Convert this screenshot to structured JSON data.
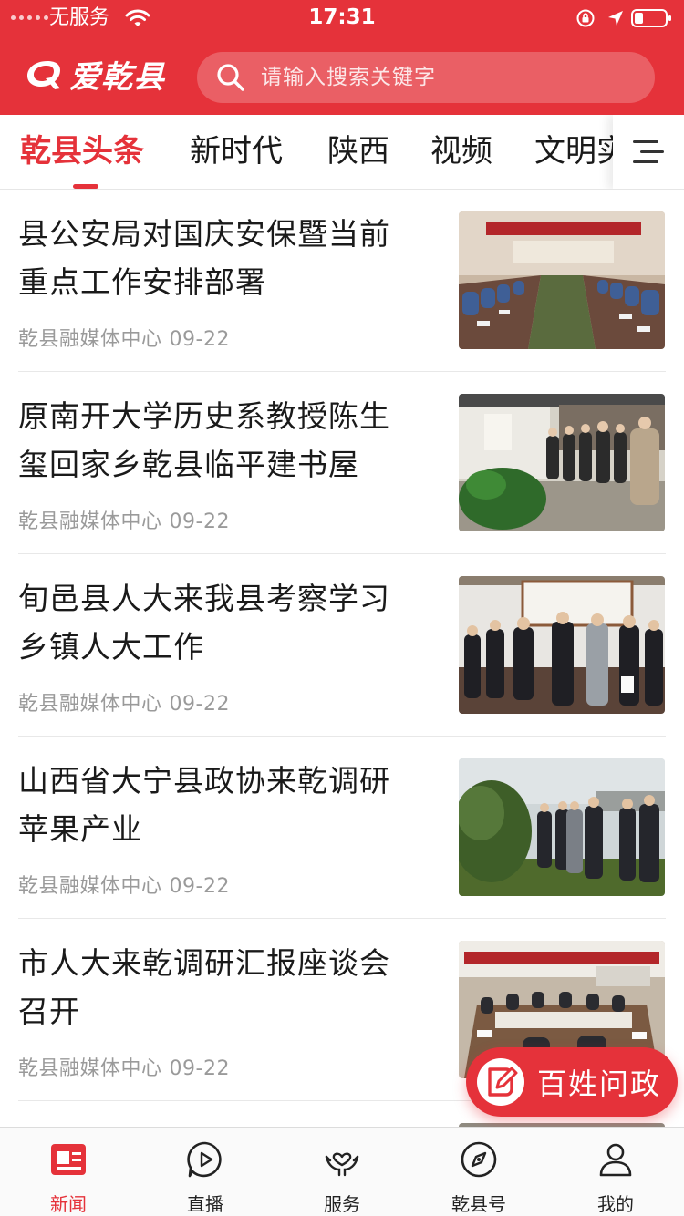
{
  "status_bar": {
    "carrier": "无服务",
    "time": "17:31"
  },
  "header": {
    "logo_text": "爱乾县",
    "search": {
      "placeholder": "请输入搜索关键字"
    }
  },
  "tabs": [
    {
      "label": "乾县头条",
      "active": true
    },
    {
      "label": "新时代",
      "active": false
    },
    {
      "label": "陕西",
      "active": false
    },
    {
      "label": "视频",
      "active": false
    },
    {
      "label": "文明实",
      "active": false
    }
  ],
  "news": [
    {
      "title": "县公安局对国庆安保暨当前重点工作安排部署",
      "source": "乾县融媒体中心",
      "date": "09-22"
    },
    {
      "title": "原南开大学历史系教授陈生玺回家乡乾县临平建书屋",
      "source": "乾县融媒体中心",
      "date": "09-22"
    },
    {
      "title": "旬邑县人大来我县考察学习乡镇人大工作",
      "source": "乾县融媒体中心",
      "date": "09-22"
    },
    {
      "title": "山西省大宁县政协来乾调研苹果产业",
      "source": "乾县融媒体中心",
      "date": "09-22"
    },
    {
      "title": "市人大来乾调研汇报座谈会召开",
      "source": "乾县融媒体中心",
      "date": "09-22"
    }
  ],
  "fab": {
    "label": "百姓问政"
  },
  "bottom_nav": [
    {
      "label": "新闻",
      "icon": "news-icon",
      "active": true
    },
    {
      "label": "直播",
      "icon": "play-icon",
      "active": false
    },
    {
      "label": "服务",
      "icon": "service-icon",
      "active": false
    },
    {
      "label": "乾县号",
      "icon": "compass-icon",
      "active": false
    },
    {
      "label": "我的",
      "icon": "user-icon",
      "active": false
    }
  ],
  "colors": {
    "accent": "#e5323a",
    "text": "#1a1a1a",
    "meta": "#9a9a9a"
  }
}
